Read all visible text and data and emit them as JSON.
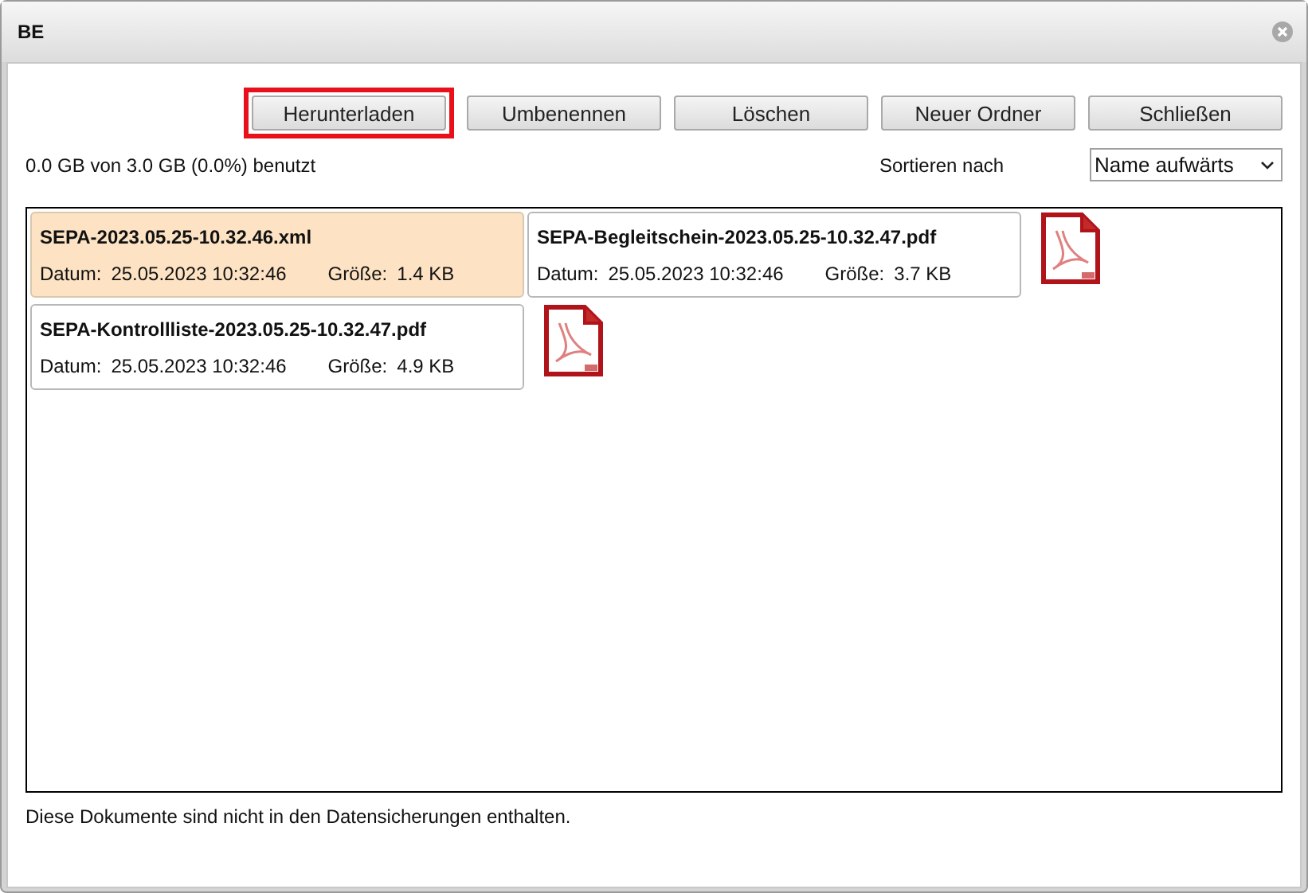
{
  "window": {
    "title": "BE"
  },
  "toolbar": {
    "buttons": [
      {
        "label": "Herunterladen",
        "highlighted": true
      },
      {
        "label": "Umbenennen",
        "highlighted": false
      },
      {
        "label": "Löschen",
        "highlighted": false
      },
      {
        "label": "Neuer Ordner",
        "highlighted": false
      },
      {
        "label": "Schließen",
        "highlighted": false
      }
    ]
  },
  "usage": "0.0 GB von 3.0 GB (0.0%) benutzt",
  "sort": {
    "label": "Sortieren nach",
    "value": "Name aufwärts"
  },
  "files": [
    {
      "name": "SEPA-2023.05.25-10.32.46.xml",
      "date_label": "Datum:",
      "date": "25.05.2023 10:32:46",
      "size_label": "Größe:",
      "size": "1.4 KB",
      "kind": "xml",
      "selected": true
    },
    {
      "name": "SEPA-Begleitschein-2023.05.25-10.32.47.pdf",
      "date_label": "Datum:",
      "date": "25.05.2023 10:32:46",
      "size_label": "Größe:",
      "size": "3.7 KB",
      "kind": "pdf",
      "selected": false
    },
    {
      "name": "SEPA-Kontrollliste-2023.05.25-10.32.47.pdf",
      "date_label": "Datum:",
      "date": "25.05.2023 10:32:46",
      "size_label": "Größe:",
      "size": "4.9 KB",
      "kind": "pdf",
      "selected": false
    }
  ],
  "footer": "Diese Dokumente sind nicht in den Datensicherungen enthalten."
}
